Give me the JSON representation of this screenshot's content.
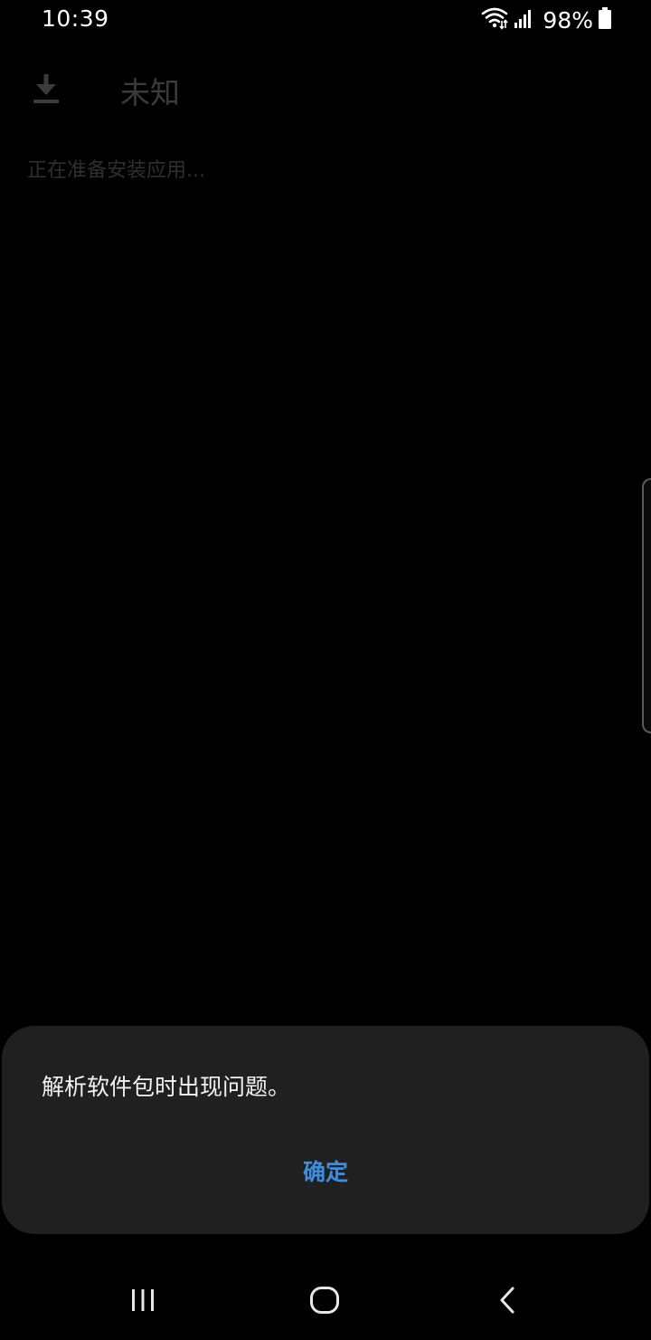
{
  "status_bar": {
    "time": "10:39",
    "battery_percent": "98%",
    "icons": [
      "wifi-icon",
      "cell-signal-icon",
      "battery-icon"
    ]
  },
  "app": {
    "title": "未知",
    "subtitle": "正在准备安装应用...",
    "header_icon": "download-icon"
  },
  "dialog": {
    "message": "解析软件包时出现问题。",
    "ok_label": "确定"
  },
  "nav_bar": {
    "icons": [
      "recents-icon",
      "home-icon",
      "back-icon"
    ]
  },
  "colors": {
    "background": "#000000",
    "dialog_bg": "#202020",
    "accent": "#3e8ee0",
    "dim_text": "#3b3b3b"
  }
}
